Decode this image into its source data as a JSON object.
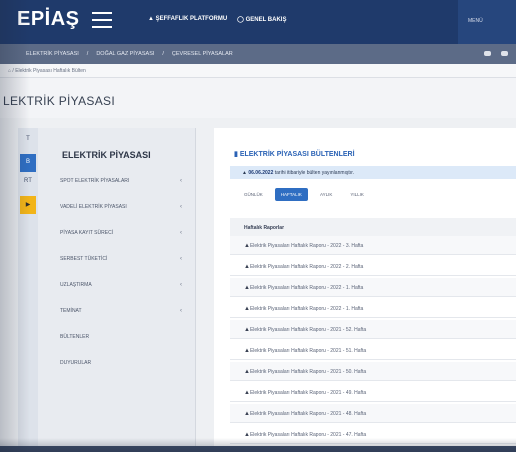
{
  "topbar": {
    "logo": "EPİAŞ",
    "nav": [
      "ŞEFFAFLIK PLATFORMU",
      "GENEL BAKIŞ"
    ],
    "right_label": "MENÜ"
  },
  "menubar": {
    "items": [
      "ELEKTRİK PİYASASI",
      "DOĞAL GAZ PİYASASI",
      "ÇEVRESEL PİYASALAR"
    ],
    "separator": "/"
  },
  "breadcrumb": {
    "home": "⌂",
    "text": "Elektrik Piyasası Haftalık Bülten"
  },
  "page": {
    "title": "LEKTRİK PİYASASI"
  },
  "sidebar": {
    "title": "ELEKTRİK PİYASASI",
    "items": [
      {
        "label": "SPOT ELEKTRİK PİYASALARI",
        "chev": "‹"
      },
      {
        "label": "VADELİ ELEKTRİK PİYASASI",
        "chev": "‹"
      },
      {
        "label": "PİYASA KAYIT SÜRECİ",
        "chev": "‹"
      },
      {
        "label": "SERBEST TÜKETİCİ",
        "chev": "‹"
      },
      {
        "label": "UZLAŞTIRMA",
        "chev": "‹"
      },
      {
        "label": "TEMİNAT",
        "chev": "‹"
      },
      {
        "label": "BÜLTENLER",
        "chev": ""
      },
      {
        "label": "DUYURULAR",
        "chev": ""
      }
    ]
  },
  "iconstrip": {
    "items": [
      "T",
      "B",
      "RT",
      "▶"
    ]
  },
  "main": {
    "title": "ELEKTRİK PİYASASI BÜLTENLERİ",
    "notice_date": "06.06.2022",
    "notice_text": "tarihi itibariyle bülten yayınlanmıştır.",
    "tabs": [
      "GÜNLÜK",
      "HAFTALIK",
      "AYLIK",
      "YILLIK"
    ],
    "table_header": "Haftalık Raporlar",
    "rows": [
      "Elektrik Piyasaları Haftalık Raporu - 2022 - 3. Hafta",
      "Elektrik Piyasaları Haftalık Raporu - 2022 - 2. Hafta",
      "Elektrik Piyasaları Haftalık Raporu - 2022 - 1. Hafta",
      "Elektrik Piyasaları Haftalık Raporu - 2022 - 1. Hafta",
      "Elektrik Piyasaları Haftalık Raporu - 2021 - 52. Hafta",
      "Elektrik Piyasaları Haftalık Raporu - 2021 - 51. Hafta",
      "Elektrik Piyasaları Haftalık Raporu - 2021 - 50. Hafta",
      "Elektrik Piyasaları Haftalık Raporu - 2021 - 49. Hafta",
      "Elektrik Piyasaları Haftalık Raporu - 2021 - 48. Hafta",
      "Elektrik Piyasaları Haftalık Raporu - 2021 - 47. Hafta"
    ]
  },
  "colors": {
    "navbar": "#1f3a6b",
    "menubar": "#5c6b87",
    "accent": "#2f6ec2",
    "highlight": "#f2b418"
  }
}
